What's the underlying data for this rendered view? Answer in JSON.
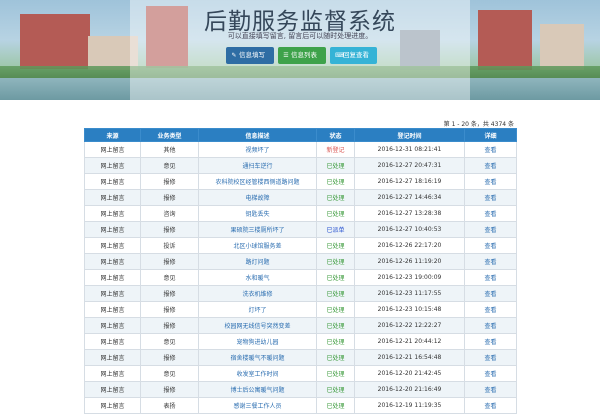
{
  "header": {
    "title": "后勤服务监督系统",
    "subtitle": "可以直接填写留言, 留言后可以随时处理进度。",
    "buttons": [
      {
        "label": "信息填写",
        "icon": "pencil-icon"
      },
      {
        "label": "信息列表",
        "icon": "list-icon"
      },
      {
        "label": "回复查看",
        "icon": "reply-icon"
      }
    ]
  },
  "pagination": {
    "info": "第 1 - 20 条，共 4374 条"
  },
  "table": {
    "columns": [
      "来源",
      "业务类型",
      "信息描述",
      "状态",
      "登记时间",
      "详细"
    ],
    "rows": [
      {
        "source": "网上留言",
        "type": "其他",
        "desc": "视频坏了",
        "status": "新登记",
        "status_kind": "new",
        "time": "2016-12-31 08:21:41",
        "detail": "查看"
      },
      {
        "source": "网上留言",
        "type": "意见",
        "desc": "通扫车逆行",
        "status": "已处理",
        "status_kind": "done",
        "time": "2016-12-27 20:47:31",
        "detail": "查看"
      },
      {
        "source": "网上留言",
        "type": "报修",
        "desc": "农科院校区经管楼西侧道路问题",
        "status": "已处理",
        "status_kind": "done",
        "time": "2016-12-27 18:16:19",
        "detail": "查看"
      },
      {
        "source": "网上留言",
        "type": "报修",
        "desc": "电梯故障",
        "status": "已处理",
        "status_kind": "done",
        "time": "2016-12-27 14:46:34",
        "detail": "查看"
      },
      {
        "source": "网上留言",
        "type": "咨询",
        "desc": "钥匙丢失",
        "status": "已处理",
        "status_kind": "done",
        "time": "2016-12-27 13:28:38",
        "detail": "查看"
      },
      {
        "source": "网上留言",
        "type": "报修",
        "desc": "果硕院三楼厕所坏了",
        "status": "已派单",
        "status_kind": "send",
        "time": "2016-12-27 10:40:53",
        "detail": "查看"
      },
      {
        "source": "网上留言",
        "type": "投诉",
        "desc": "北区小球馆服务差",
        "status": "已处理",
        "status_kind": "done",
        "time": "2016-12-26 22:17:20",
        "detail": "查看"
      },
      {
        "source": "网上留言",
        "type": "报修",
        "desc": "路灯问题",
        "status": "已处理",
        "status_kind": "done",
        "time": "2016-12-26 11:19:20",
        "detail": "查看"
      },
      {
        "source": "网上留言",
        "type": "意见",
        "desc": "水和暖气",
        "status": "已处理",
        "status_kind": "done",
        "time": "2016-12-23 19:00:09",
        "detail": "查看"
      },
      {
        "source": "网上留言",
        "type": "报修",
        "desc": "洗衣机维修",
        "status": "已处理",
        "status_kind": "done",
        "time": "2016-12-23 11:17:55",
        "detail": "查看"
      },
      {
        "source": "网上留言",
        "type": "报修",
        "desc": "灯坏了",
        "status": "已处理",
        "status_kind": "done",
        "time": "2016-12-23 10:15:48",
        "detail": "查看"
      },
      {
        "source": "网上留言",
        "type": "报修",
        "desc": "校园网无线信号突然变差",
        "status": "已处理",
        "status_kind": "done",
        "time": "2016-12-22 12:22:27",
        "detail": "查看"
      },
      {
        "source": "网上留言",
        "type": "意见",
        "desc": "宠物狗进幼儿园",
        "status": "已处理",
        "status_kind": "done",
        "time": "2016-12-21 20:44:12",
        "detail": "查看"
      },
      {
        "source": "网上留言",
        "type": "报修",
        "desc": "宿舍楼暖气不暖问题",
        "status": "已处理",
        "status_kind": "done",
        "time": "2016-12-21 16:54:48",
        "detail": "查看"
      },
      {
        "source": "网上留言",
        "type": "意见",
        "desc": "收发室工作时间",
        "status": "已处理",
        "status_kind": "done",
        "time": "2016-12-20 21:42:45",
        "detail": "查看"
      },
      {
        "source": "网上留言",
        "type": "报修",
        "desc": "博士后公寓暖气问题",
        "status": "已处理",
        "status_kind": "done",
        "time": "2016-12-20 21:16:49",
        "detail": "查看"
      },
      {
        "source": "网上留言",
        "type": "表扬",
        "desc": "感谢三餐工作人员",
        "status": "已处理",
        "status_kind": "done",
        "time": "2016-12-19 11:19:35",
        "detail": "查看"
      }
    ]
  },
  "colors": {
    "header_bg": "#2b7fc2",
    "new": "#d9534f",
    "done": "#3a9a3a",
    "dispatched": "#2550d0",
    "link": "#2a6db0"
  }
}
